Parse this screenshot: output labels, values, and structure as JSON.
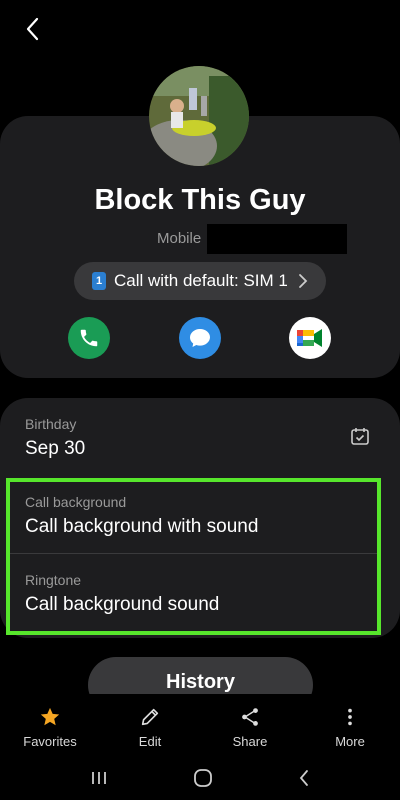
{
  "header": {
    "back_icon": "chevron-left-icon"
  },
  "contact": {
    "name": "Block This Guy",
    "mobile_label": "Mobile",
    "sim_badge": "1",
    "call_default_label": "Call with default: SIM 1"
  },
  "actions": [
    {
      "name": "call",
      "icon": "phone-icon",
      "color": "#1a9c55"
    },
    {
      "name": "message",
      "icon": "chat-bubble-icon",
      "color": "#2f8de4"
    },
    {
      "name": "video",
      "icon": "meet-icon",
      "color": "#ffffff"
    }
  ],
  "details": {
    "birthday_label": "Birthday",
    "birthday_value": "Sep 30",
    "call_background_label": "Call background",
    "call_background_value": "Call background with sound",
    "ringtone_label": "Ringtone",
    "ringtone_value": "Call background sound"
  },
  "history_label": "History",
  "bottom_bar": [
    {
      "label": "Favorites",
      "icon": "star-icon"
    },
    {
      "label": "Edit",
      "icon": "pencil-icon"
    },
    {
      "label": "Share",
      "icon": "share-icon"
    },
    {
      "label": "More",
      "icon": "more-vertical-icon"
    }
  ],
  "colors": {
    "highlight": "#57e62c",
    "star": "#f5a623",
    "card": "#1d1d1f"
  }
}
